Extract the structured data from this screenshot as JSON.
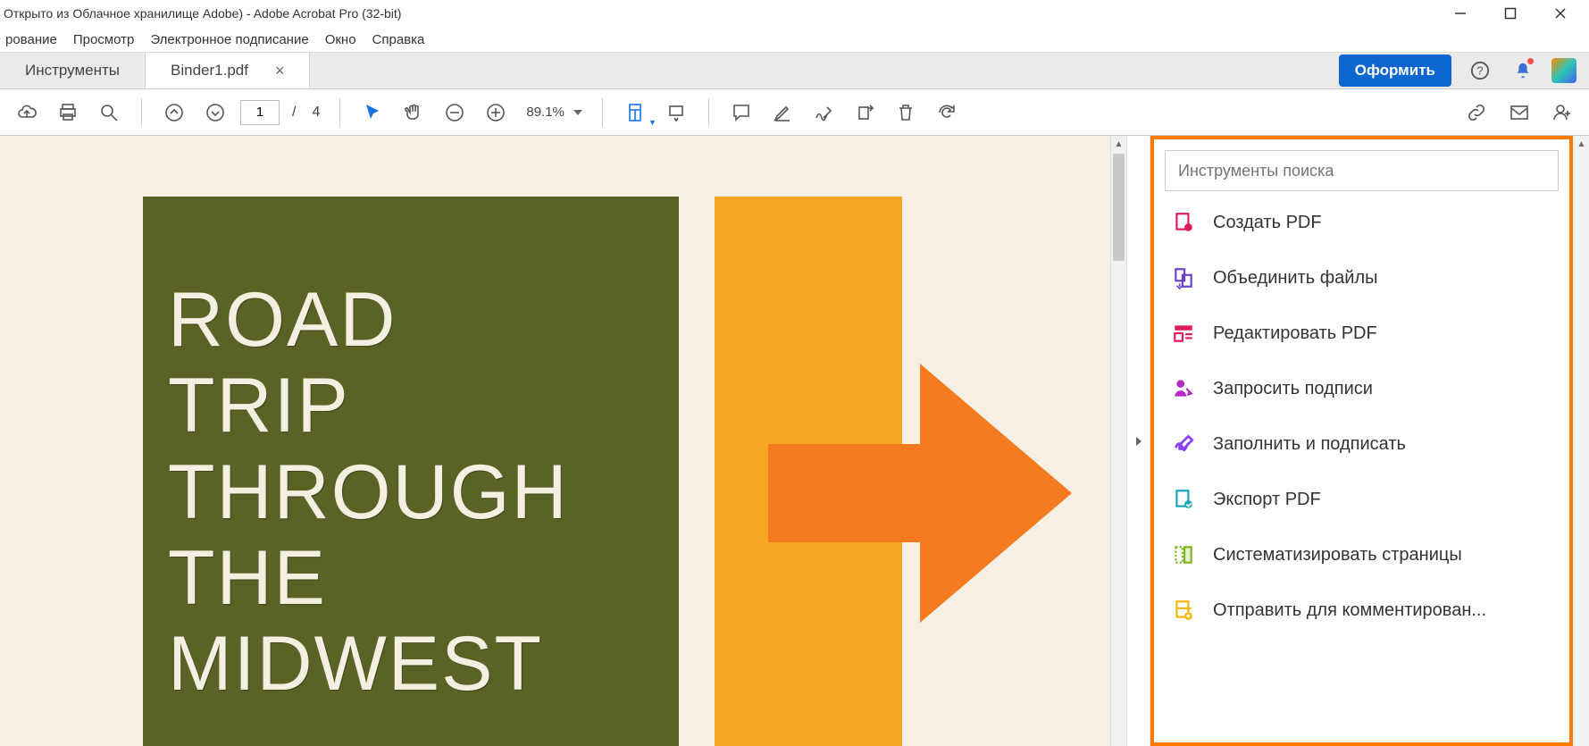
{
  "window": {
    "title": "Открыто из Облачное хранилище Adobe) - Adobe Acrobat Pro (32-bit)"
  },
  "menu": {
    "items": [
      "рование",
      "Просмотр",
      "Электронное подписание",
      "Окно",
      "Справка"
    ]
  },
  "tabs": {
    "tools_tab": "Инструменты",
    "doc_tab": "Binder1.pdf",
    "subscribe": "Оформить"
  },
  "toolbar": {
    "page_current": "1",
    "page_sep": "/",
    "page_total": "4",
    "zoom": "89.1%"
  },
  "document": {
    "heading": "ROAD\nTRIP\nTHROUGH\nTHE\nMIDWEST"
  },
  "tools_panel": {
    "search_placeholder": "Инструменты поиска",
    "items": [
      {
        "label": "Создать PDF",
        "color": "#e1195e"
      },
      {
        "label": "Объединить файлы",
        "color": "#6b3fd1"
      },
      {
        "label": "Редактировать PDF",
        "color": "#e1195e"
      },
      {
        "label": "Запросить подписи",
        "color": "#b729c4"
      },
      {
        "label": "Заполнить и подписать",
        "color": "#8a3ffc"
      },
      {
        "label": "Экспорт PDF",
        "color": "#17a2b8"
      },
      {
        "label": "Систематизировать страницы",
        "color": "#7cb518"
      },
      {
        "label": "Отправить для комментирован...",
        "color": "#f2b705"
      }
    ]
  }
}
